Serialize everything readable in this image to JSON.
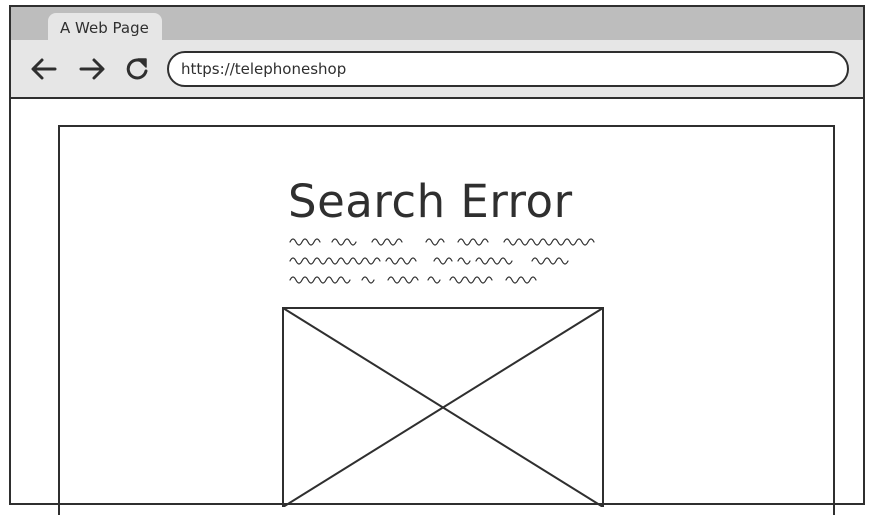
{
  "browser": {
    "tab_title": "A Web Page",
    "url": "https://telephoneshop"
  },
  "icons": {
    "back": "arrow-left-icon",
    "forward": "arrow-right-icon",
    "reload": "reload-icon"
  },
  "page": {
    "heading": "Search Error",
    "placeholder_text_lines": 3,
    "image_placeholder": "image-placeholder"
  },
  "colors": {
    "ink": "#2f2f2f",
    "tab_strip": "#bdbdbd",
    "toolbar": "#e6e6e6"
  }
}
